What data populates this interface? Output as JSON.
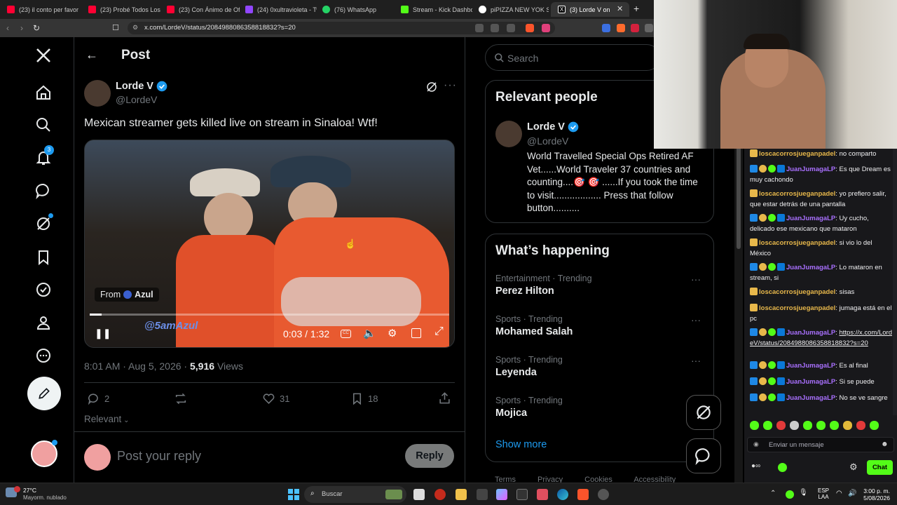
{
  "browser": {
    "tabs": [
      {
        "label": "(23) il conto per favor",
        "color": "#ff0033"
      },
      {
        "label": "(23) Probé Todos Los F",
        "color": "#ff0033"
      },
      {
        "label": "(23) Con Ánimo de Of",
        "color": "#ff0033"
      },
      {
        "label": "(24) 0xultravioleta - Tw",
        "color": "#9146ff"
      },
      {
        "label": "(76) WhatsApp",
        "color": "#25d366"
      },
      {
        "label": "Stream - Kick Dashbo",
        "color": "#53fc18"
      },
      {
        "label": "piPIZZA NEW YOK STY",
        "color": "#ffffff"
      },
      {
        "label": "(3) Lorde V on",
        "color": "#ffffff"
      }
    ],
    "url": "x.com/LordeV/status/2084988086358818832?s=20"
  },
  "nav": {
    "notif_count": "3"
  },
  "post": {
    "header": "Post",
    "author_name": "Lorde V",
    "author_handle": "@LordeV",
    "text": "Mexican streamer gets killed live on stream in Sinaloa! Wtf!",
    "video": {
      "from_label": "From",
      "from_name": "Azul",
      "watermark": "@5amAzul",
      "time": "0:03 / 1:32",
      "progress": 0.034
    },
    "meta_time": "8:01 AM · Aug 5, 2026 ·",
    "views_count": "5,916",
    "views_label": "Views",
    "replies": "2",
    "likes": "31",
    "bookmarks": "18",
    "sort_label": "Relevant",
    "reply_placeholder": "Post your reply",
    "reply_button": "Reply"
  },
  "sidebar": {
    "search_placeholder": "Search",
    "relevant_title": "Relevant people",
    "person_name": "Lorde V",
    "person_handle": "@LordeV",
    "person_bio": "World Travelled Special Ops Retired AF Vet......World Traveler 37 countries and counting....🎯 🎯 ......If you took the time to visit.................. Press that follow button..........",
    "happening_title": "What’s happening",
    "trends": [
      {
        "category": "Entertainment · Trending",
        "name": "Perez Hilton"
      },
      {
        "category": "Sports · Trending",
        "name": "Mohamed Salah"
      },
      {
        "category": "Sports · Trending",
        "name": "Leyenda"
      },
      {
        "category": "Sports · Trending",
        "name": "Mojica"
      }
    ],
    "show_more": "Show more",
    "footer": [
      "Terms",
      "Privacy",
      "Cookies",
      "Accessibility"
    ]
  },
  "chat": {
    "messages": [
      {
        "user": "loscacorrosjueganpadel",
        "type": 1,
        "text": "no comparto"
      },
      {
        "user": "JuanJumagaLP",
        "type": 2,
        "text": "Es que Dream es muy cachondo"
      },
      {
        "user": "loscacorrosjueganpadel",
        "type": 1,
        "text": "yo prefiero salir, que estar detrás de una pantalla"
      },
      {
        "user": "JuanJumagaLP",
        "type": 2,
        "text": "Uy cucho, delicado ese mexicano que mataron"
      },
      {
        "user": "loscacorrosjueganpadel",
        "type": 1,
        "text": "si vio lo del México"
      },
      {
        "user": "JuanJumagaLP",
        "type": 2,
        "text": "Lo mataron en stream, si"
      },
      {
        "user": "loscacorrosjueganpadel",
        "type": 1,
        "text": "sisas"
      },
      {
        "user": "loscacorrosjueganpadel",
        "type": 1,
        "text": "jumaga está en el pc"
      },
      {
        "user": "JuanJumagaLP",
        "type": 2,
        "text": "https://x.com/LordeV/status/2084988086358818832?s=20"
      },
      {
        "user": "JuanJumagaLP",
        "type": 2,
        "text": "Es al final"
      },
      {
        "user": "JuanJumagaLP",
        "type": 2,
        "text": "Si se puede"
      },
      {
        "user": "JuanJumagaLP",
        "type": 2,
        "text": "No se ve sangre"
      }
    ],
    "input_placeholder": "Enviar un mensaje",
    "chat_button": "Chat"
  },
  "taskbar": {
    "weather_temp": "27°C",
    "weather_desc": "Mayorm. nublado",
    "search_label": "Buscar",
    "lang1": "ESP",
    "lang2": "LAA",
    "time": "3:00 p. m.",
    "date": "5/08/2026"
  }
}
